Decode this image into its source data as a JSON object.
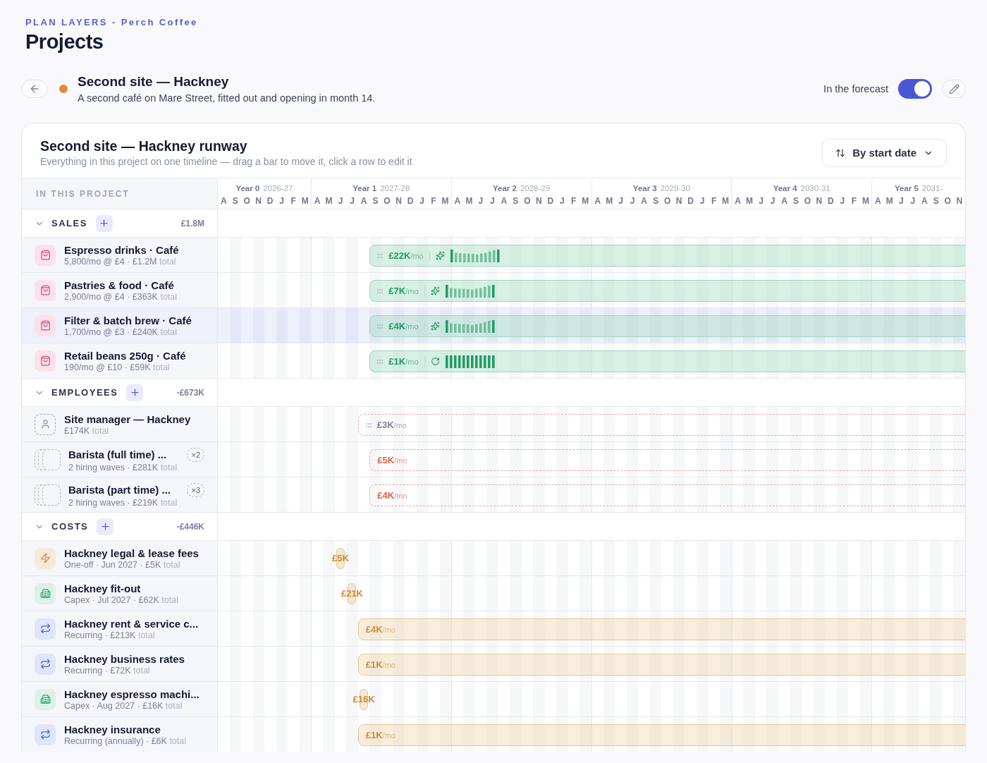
{
  "header": {
    "eyebrow": "PLAN LAYERS - Perch Coffee",
    "title": "Projects"
  },
  "project": {
    "name": "Second site — Hackney",
    "description": "A second café on Mare Street, fitted out and opening in month 14.",
    "forecast_label": "In the forecast",
    "in_forecast": true
  },
  "runway": {
    "title": "Second site — Hackney runway",
    "subtitle": "Everything in this project on one timeline — drag a bar to move it, click a row to edit it",
    "sort": "By start date",
    "column_label": "IN THIS PROJECT"
  },
  "timeline": {
    "years": [
      {
        "label": "Year 0",
        "range": "2026-27",
        "months": [
          "A",
          "S",
          "O",
          "N",
          "D",
          "J",
          "F",
          "M"
        ]
      },
      {
        "label": "Year 1",
        "range": "2027-28",
        "months": [
          "A",
          "M",
          "J",
          "J",
          "A",
          "S",
          "O",
          "N",
          "D",
          "J",
          "F",
          "M"
        ]
      },
      {
        "label": "Year 2",
        "range": "2028-29",
        "months": [
          "A",
          "M",
          "J",
          "J",
          "A",
          "S",
          "O",
          "N",
          "D",
          "J",
          "F",
          "M"
        ]
      },
      {
        "label": "Year 3",
        "range": "2029-30",
        "months": [
          "A",
          "M",
          "J",
          "J",
          "A",
          "S",
          "O",
          "N",
          "D",
          "J",
          "F",
          "M"
        ]
      },
      {
        "label": "Year 4",
        "range": "2030-31",
        "months": [
          "A",
          "M",
          "J",
          "J",
          "A",
          "S",
          "O",
          "N",
          "D",
          "J",
          "F",
          "M"
        ]
      },
      {
        "label": "Year 5",
        "range": "2031-",
        "months": [
          "A",
          "M",
          "J",
          "J",
          "A",
          "S",
          "O",
          "N"
        ]
      }
    ]
  },
  "sections": [
    {
      "label": "SALES",
      "total": "£1.8M",
      "expanded": true,
      "rows": [
        {
          "kind": "sale",
          "name": "Espresso drinks · Café",
          "detail": "5,800/mo @ £4 · £1.2M",
          "detail_note": "total",
          "selected": false,
          "bar": {
            "kind": "seasonal",
            "amount": "£22K",
            "unit": "/mo",
            "handle": true
          }
        },
        {
          "kind": "sale",
          "name": "Pastries & food · Café",
          "detail": "2,900/mo @ £4 · £363K",
          "detail_note": "total",
          "selected": false,
          "bar": {
            "kind": "seasonal",
            "amount": "£7K",
            "unit": "/mo",
            "handle": true
          }
        },
        {
          "kind": "sale",
          "name": "Filter & batch brew · Café",
          "detail": "1,700/mo @ £3 · £240K",
          "detail_note": "total",
          "selected": true,
          "bar": {
            "kind": "seasonal",
            "amount": "£4K",
            "unit": "/mo",
            "handle": true
          }
        },
        {
          "kind": "sale",
          "name": "Retail beans 250g · Café",
          "detail": "190/mo @ £10 · £59K",
          "detail_note": "total",
          "selected": false,
          "bar": {
            "kind": "steady",
            "amount": "£1K",
            "unit": "/mo",
            "handle": true
          }
        }
      ]
    },
    {
      "label": "EMPLOYEES",
      "total": "-£673K",
      "expanded": true,
      "rows": [
        {
          "kind": "hire",
          "name": "Site manager — Hackney",
          "detail": "£174K",
          "detail_note": "total",
          "selected": false,
          "bar": {
            "kind": "salary",
            "amount": "£3K",
            "unit": "/mo",
            "muted": true,
            "handle": true
          }
        },
        {
          "kind": "hire_wave",
          "name": "Barista (full time) ...",
          "count": "×2",
          "detail": "2 hiring waves · £281K",
          "detail_note": "total",
          "selected": false,
          "bar": {
            "kind": "salary",
            "amount": "£5K",
            "unit": "/mo",
            "muted": false,
            "handle": false
          }
        },
        {
          "kind": "hire_wave",
          "name": "Barista (part time) ...",
          "count": "×3",
          "detail": "2 hiring waves · £219K",
          "detail_note": "total",
          "selected": false,
          "bar": {
            "kind": "salary",
            "amount": "£4K",
            "unit": "/mo",
            "muted": false,
            "handle": false
          }
        }
      ]
    },
    {
      "label": "COSTS",
      "total": "-£446K",
      "expanded": true,
      "rows": [
        {
          "kind": "one_off",
          "name": "Hackney legal & lease fees",
          "detail": "One-off · Jun 2027 · £5K",
          "detail_note": "total",
          "selected": false,
          "bar": {
            "kind": "one_off",
            "amount": "£5K"
          }
        },
        {
          "kind": "capex",
          "name": "Hackney fit-out",
          "detail": "Capex · Jul 2027 · £62K",
          "detail_note": "total",
          "selected": false,
          "bar": {
            "kind": "one_off",
            "amount": "£21K"
          }
        },
        {
          "kind": "recurring",
          "name": "Hackney rent & service c...",
          "detail": "Recurring · £213K",
          "detail_note": "total",
          "selected": false,
          "bar": {
            "kind": "recurring",
            "amount": "£4K",
            "unit": "/mo"
          }
        },
        {
          "kind": "recurring",
          "name": "Hackney business rates",
          "detail": "Recurring · £72K",
          "detail_note": "total",
          "selected": false,
          "bar": {
            "kind": "recurring",
            "amount": "£1K",
            "unit": "/mo"
          }
        },
        {
          "kind": "capex",
          "name": "Hackney espresso machi...",
          "detail": "Capex · Aug 2027 · £16K",
          "detail_note": "total",
          "selected": false,
          "bar": {
            "kind": "one_off",
            "amount": "£16K"
          }
        },
        {
          "kind": "recurring",
          "name": "Hackney insurance",
          "detail": "Recurring (annually) · £6K",
          "detail_note": "total",
          "selected": false,
          "bar": {
            "kind": "recurring",
            "amount": "£1K",
            "unit": "/mo"
          }
        }
      ]
    }
  ]
}
